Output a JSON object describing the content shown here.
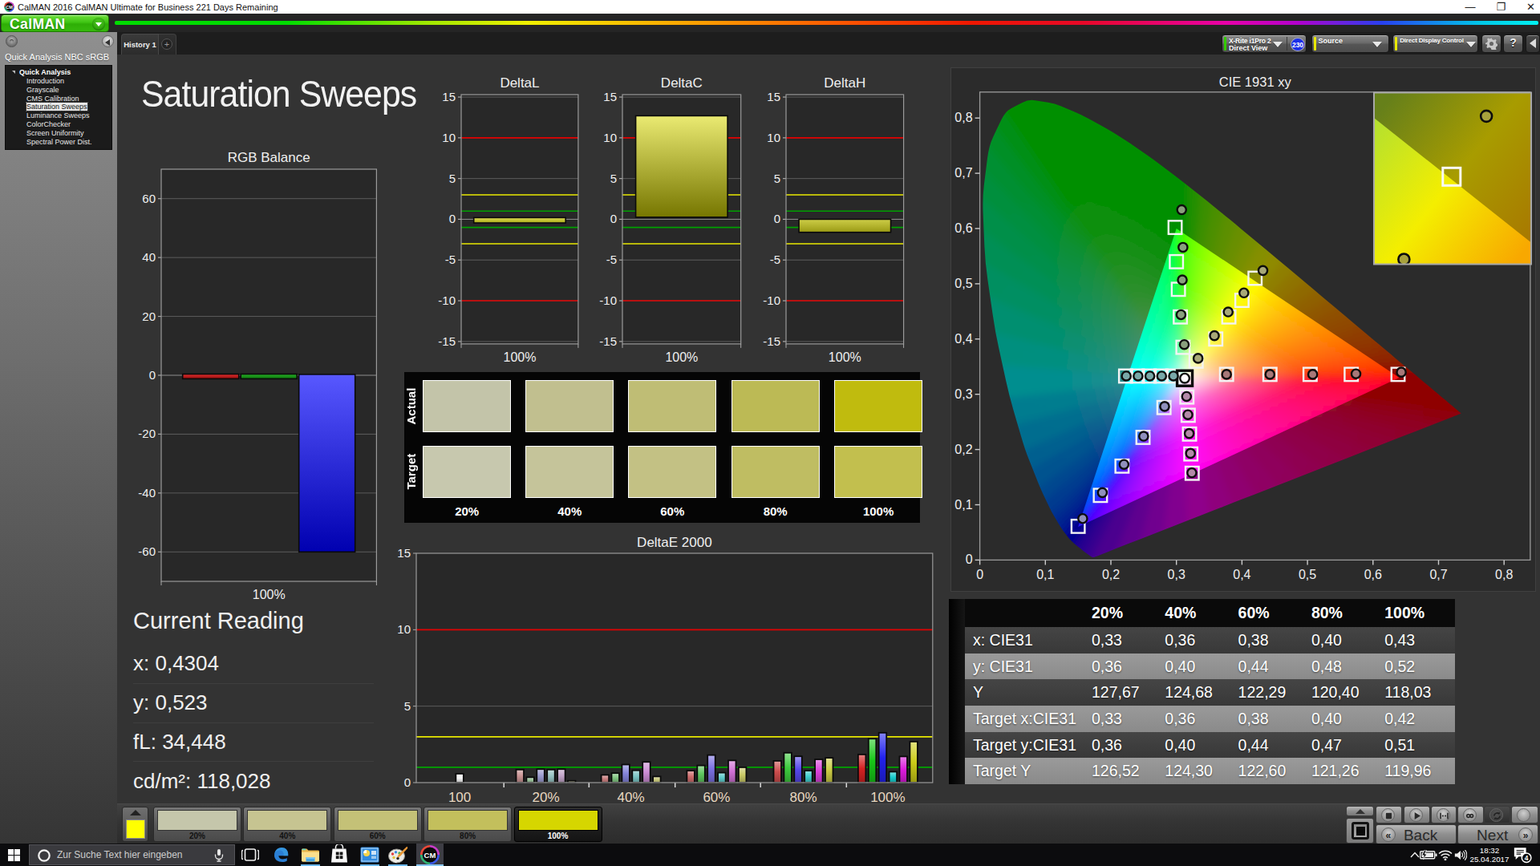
{
  "window": {
    "title": "CalMAN 2016 CalMAN Ultimate for Business 221 Days Remaining",
    "controls": [
      "minimize",
      "restore",
      "close"
    ]
  },
  "logo": {
    "label": "CalMAN"
  },
  "tabs": {
    "active": "History 1",
    "add_label": "+"
  },
  "top_controls": {
    "meter": {
      "line1": "X-Rite i1Pro 2",
      "line2": "Direct View",
      "badge": "230",
      "accent": "#33cc00"
    },
    "source": {
      "line1": "Source",
      "line2": "",
      "accent": "#e8e800"
    },
    "display_control": {
      "line1": "Direct Display Control",
      "line2": "",
      "accent": "#e8e800"
    },
    "buttons": [
      "settings",
      "help",
      "collapse"
    ]
  },
  "sidebar": {
    "title": "Quick Analysis NBC sRGB",
    "root": "Quick Analysis",
    "items": [
      {
        "label": "Introduction",
        "selected": false
      },
      {
        "label": "Grayscale",
        "selected": false
      },
      {
        "label": "CMS Calibration",
        "selected": false
      },
      {
        "label": "Saturation Sweeps",
        "selected": true
      },
      {
        "label": "Luminance Sweeps",
        "selected": false
      },
      {
        "label": "ColorChecker",
        "selected": false
      },
      {
        "label": "Screen Uniformity",
        "selected": false
      },
      {
        "label": "Spectral Power Dist.",
        "selected": false
      }
    ]
  },
  "page": {
    "title": "Saturation Sweeps"
  },
  "current_reading": {
    "title": "Current Reading",
    "values": [
      {
        "label": "x",
        "text": "x: 0,4304"
      },
      {
        "label": "y",
        "text": "y: 0,523"
      },
      {
        "label": "fL",
        "text": "fL: 34,448"
      },
      {
        "label": "cd/m²",
        "text": "cd/m²: 118,028"
      }
    ]
  },
  "chart_data": [
    {
      "id": "rgb_balance",
      "type": "bar",
      "title": "RGB Balance",
      "xlabel": "100%",
      "ylim": [
        -70,
        70
      ],
      "yticks": [
        -60,
        -40,
        -20,
        0,
        20,
        40,
        60
      ],
      "categories": [
        "red",
        "green",
        "blue"
      ],
      "values": [
        -1.2,
        -1.2,
        -60
      ],
      "bar_tops": [
        0.4,
        0.4,
        0.3
      ],
      "colors_top": [
        "#e83030",
        "#28b428",
        "#5858ff"
      ],
      "colors_bot": [
        "#8c0c0c",
        "#0c700c",
        "#0000b0"
      ]
    },
    {
      "id": "deltaL",
      "type": "bar",
      "title": "DeltaL",
      "xlabel": "100%",
      "ylim": [
        -15.3,
        15.3
      ],
      "yticks": [
        -15,
        -10,
        -5,
        0,
        5,
        10,
        15
      ],
      "guides": [
        {
          "y": 10,
          "color": "#e00000"
        },
        {
          "y": -10,
          "color": "#e00000"
        },
        {
          "y": 3,
          "color": "#e8e800"
        },
        {
          "y": -3,
          "color": "#e8e800"
        },
        {
          "y": 1,
          "color": "#00a000"
        },
        {
          "y": -1,
          "color": "#00a000"
        }
      ],
      "categories": [
        "100%"
      ],
      "values": [
        -0.45
      ],
      "bar_tops": [
        0.2
      ],
      "colors_top": [
        "#dede52"
      ],
      "colors_bot": [
        "#a8a818"
      ]
    },
    {
      "id": "deltaC",
      "type": "bar",
      "title": "DeltaC",
      "xlabel": "100%",
      "ylim": [
        -15.3,
        15.3
      ],
      "yticks": [
        -15,
        -10,
        -5,
        0,
        5,
        10,
        15
      ],
      "guides": [
        {
          "y": 10,
          "color": "#e00000"
        },
        {
          "y": -10,
          "color": "#e00000"
        },
        {
          "y": 3,
          "color": "#e8e800"
        },
        {
          "y": -3,
          "color": "#e8e800"
        },
        {
          "y": 1,
          "color": "#00a000"
        },
        {
          "y": -1,
          "color": "#00a000"
        }
      ],
      "categories": [
        "100%"
      ],
      "values": [
        12.7
      ],
      "bar_tops": [
        0.25
      ],
      "colors_top": [
        "#eaea72"
      ],
      "colors_bot": [
        "#767600"
      ]
    },
    {
      "id": "deltaH",
      "type": "bar",
      "title": "DeltaH",
      "xlabel": "100%",
      "ylim": [
        -15.3,
        15.3
      ],
      "yticks": [
        -15,
        -10,
        -5,
        0,
        5,
        10,
        15
      ],
      "guides": [
        {
          "y": 10,
          "color": "#e00000"
        },
        {
          "y": -10,
          "color": "#e00000"
        },
        {
          "y": 3,
          "color": "#e8e800"
        },
        {
          "y": -3,
          "color": "#e8e800"
        },
        {
          "y": 1,
          "color": "#00a000"
        },
        {
          "y": -1,
          "color": "#00a000"
        }
      ],
      "categories": [
        "100%"
      ],
      "values": [
        -1.6
      ],
      "bar_tops": [
        0.0
      ],
      "colors_top": [
        "#cece48"
      ],
      "colors_bot": [
        "#9a9a14"
      ]
    },
    {
      "id": "deltaE",
      "type": "bar",
      "title": "DeltaE 2000",
      "ylim": [
        0,
        15
      ],
      "yticks": [
        0,
        5,
        10,
        15
      ],
      "guides": [
        {
          "y": 10,
          "color": "#e00000"
        },
        {
          "y": 3,
          "color": "#e8e800"
        },
        {
          "y": 1,
          "color": "#00a400"
        }
      ],
      "categories": [
        "100",
        "20%",
        "40%",
        "60%",
        "80%",
        "100%"
      ],
      "series_labels": [
        "white",
        "red",
        "green",
        "blue",
        "cyan",
        "magenta",
        "yellow"
      ],
      "groups": [
        {
          "label": "100",
          "values": [
            0.58
          ],
          "colors": [
            "#f2f2f2"
          ]
        },
        {
          "label": "20%",
          "values": [
            0.85,
            0.35,
            0.88,
            0.85,
            0.88,
            0.12
          ],
          "colors": [
            "#c89292",
            "#9cc49c",
            "#9a9ace",
            "#96c2c2",
            "#c2a4c8",
            "#c8c89c"
          ]
        },
        {
          "label": "40%",
          "values": [
            0.5,
            0.62,
            1.18,
            0.8,
            1.35,
            0.4
          ],
          "colors": [
            "#c87e7e",
            "#80c480",
            "#8484da",
            "#7ac4c4",
            "#cc8cd4",
            "#caca7e"
          ]
        },
        {
          "label": "60%",
          "values": [
            0.78,
            1.12,
            1.8,
            0.65,
            1.45,
            1.0
          ],
          "colors": [
            "#cc6a6a",
            "#5ec65e",
            "#7a70e2",
            "#5ecaca",
            "#d070d4",
            "#caca66"
          ]
        },
        {
          "label": "80%",
          "values": [
            1.42,
            1.95,
            1.72,
            0.78,
            1.52,
            1.62
          ],
          "colors": [
            "#cc4c4c",
            "#3ecc3e",
            "#5648ec",
            "#3ecccc",
            "#dc42dc",
            "#cccc44"
          ]
        },
        {
          "label": "100%",
          "values": [
            1.84,
            2.87,
            3.26,
            0.71,
            1.71,
            2.68
          ],
          "colors": [
            "#d42222",
            "#18c818",
            "#2222ee",
            "#18cccc",
            "#dd1cdd",
            "#cccc18"
          ]
        }
      ]
    },
    {
      "id": "cie",
      "type": "scatter",
      "title": "CIE 1931 xy",
      "xlim": [
        0,
        0.84
      ],
      "ylim": [
        0,
        0.847
      ],
      "xticks": [
        "0",
        "0,1",
        "0,2",
        "0,3",
        "0,4",
        "0,5",
        "0,6",
        "0,7",
        "0,8"
      ],
      "yticks": [
        "0",
        "0,1",
        "0,2",
        "0,3",
        "0,4",
        "0,5",
        "0,6",
        "0,7",
        "0,8"
      ],
      "white_point": {
        "x": 0.3127,
        "y": 0.329
      },
      "targets": {
        "red": [
          [
            0.3765,
            0.336
          ],
          [
            0.4427,
            0.336
          ],
          [
            0.504,
            0.336
          ],
          [
            0.5668,
            0.336
          ],
          [
            0.6382,
            0.336
          ]
        ],
        "green": [
          [
            0.31,
            0.385
          ],
          [
            0.306,
            0.44
          ],
          [
            0.303,
            0.49
          ],
          [
            0.3,
            0.54
          ],
          [
            0.298,
            0.602
          ]
        ],
        "blue": [
          [
            0.281,
            0.276
          ],
          [
            0.249,
            0.222
          ],
          [
            0.217,
            0.17
          ],
          [
            0.184,
            0.117
          ],
          [
            0.15,
            0.061
          ]
        ],
        "cyan": [
          [
            0.2225,
            0.333
          ],
          [
            0.2405,
            0.333
          ],
          [
            0.2585,
            0.333
          ],
          [
            0.2765,
            0.333
          ],
          [
            0.2945,
            0.333
          ]
        ],
        "magenta": [
          [
            0.316,
            0.295
          ],
          [
            0.318,
            0.262
          ],
          [
            0.32,
            0.228
          ],
          [
            0.322,
            0.192
          ],
          [
            0.324,
            0.157
          ]
        ],
        "yellow": [
          [
            0.33,
            0.36
          ],
          [
            0.36,
            0.4
          ],
          [
            0.38,
            0.44
          ],
          [
            0.4,
            0.47
          ],
          [
            0.42,
            0.51
          ]
        ]
      },
      "measured": {
        "red": [
          [
            0.3765,
            0.336
          ],
          [
            0.4427,
            0.336
          ],
          [
            0.508,
            0.336
          ],
          [
            0.574,
            0.337
          ],
          [
            0.6432,
            0.34
          ]
        ],
        "green": [
          [
            0.312,
            0.39
          ],
          [
            0.307,
            0.444
          ],
          [
            0.309,
            0.507
          ],
          [
            0.31,
            0.566
          ],
          [
            0.308,
            0.634
          ]
        ],
        "blue": [
          [
            0.282,
            0.278
          ],
          [
            0.25,
            0.224
          ],
          [
            0.22,
            0.173
          ],
          [
            0.187,
            0.122
          ],
          [
            0.157,
            0.075
          ]
        ],
        "cyan": [
          [
            0.2235,
            0.333
          ],
          [
            0.2415,
            0.333
          ],
          [
            0.2595,
            0.333
          ],
          [
            0.2775,
            0.333
          ],
          [
            0.2955,
            0.333
          ]
        ],
        "magenta": [
          [
            0.3155,
            0.296
          ],
          [
            0.3175,
            0.263
          ],
          [
            0.3195,
            0.229
          ],
          [
            0.3215,
            0.193
          ],
          [
            0.3235,
            0.158
          ]
        ],
        "yellow": [
          [
            0.333,
            0.365
          ],
          [
            0.358,
            0.406
          ],
          [
            0.379,
            0.449
          ],
          [
            0.403,
            0.4835
          ],
          [
            0.432,
            0.524
          ]
        ]
      },
      "dot_fills": {
        "red": "#a87878",
        "green": "#8aa07e",
        "blue": "#9090bc",
        "cyan": "#78a8a8",
        "magenta": "#b48aa8",
        "yellow": "#a8a878",
        "white": "#ffffff"
      },
      "inset": {
        "center": [
          0.41967,
          0.50529
        ],
        "span": 0.028,
        "square": [
          0.4195,
          0.5056
        ],
        "circles": [
          [
            0.42569,
            0.51638
          ],
          [
            0.41101,
            0.49087
          ]
        ]
      }
    }
  ],
  "swatch_panel": {
    "row_labels": [
      "Actual",
      "Target"
    ],
    "col_labels": [
      "20%",
      "40%",
      "60%",
      "80%",
      "100%"
    ],
    "actual": [
      "#c3c4a9",
      "#c1bf8f",
      "#bfbd75",
      "#bcba55",
      "#c0bb0e"
    ],
    "target": [
      "#c7c8ae",
      "#c5c49a",
      "#c3c184",
      "#bfbd62",
      "#c2bf4e"
    ]
  },
  "data_table": {
    "col_headers": [
      "20%",
      "40%",
      "60%",
      "80%",
      "100%"
    ],
    "rows": [
      {
        "label": "x: CIE31",
        "values": [
          "0,33",
          "0,36",
          "0,38",
          "0,40",
          "0,43"
        ],
        "shade": "dark"
      },
      {
        "label": "y: CIE31",
        "values": [
          "0,36",
          "0,40",
          "0,44",
          "0,48",
          "0,52"
        ],
        "shade": "lite"
      },
      {
        "label": "Y",
        "values": [
          "127,67",
          "124,68",
          "122,29",
          "120,40",
          "118,03"
        ],
        "shade": "dark"
      },
      {
        "label": "Target x:CIE31",
        "values": [
          "0,33",
          "0,36",
          "0,38",
          "0,40",
          "0,42"
        ],
        "shade": "lite"
      },
      {
        "label": "Target y:CIE31",
        "values": [
          "0,36",
          "0,40",
          "0,44",
          "0,47",
          "0,51"
        ],
        "shade": "dark"
      },
      {
        "label": "Target Y",
        "values": [
          "126,52",
          "124,30",
          "122,60",
          "121,26",
          "119,96"
        ],
        "shade": "lite"
      }
    ]
  },
  "bottom_bar": {
    "current_patch": "#ffff00",
    "patches": [
      {
        "label": "20%",
        "color": "#c5c6ab",
        "selected": false
      },
      {
        "label": "40%",
        "color": "#c6c491",
        "selected": false
      },
      {
        "label": "60%",
        "color": "#c4c177",
        "selected": false
      },
      {
        "label": "80%",
        "color": "#c3bf5c",
        "selected": false
      },
      {
        "label": "100%",
        "color": "#d6d600",
        "selected": true
      }
    ],
    "back_label": "Back",
    "next_label": "Next",
    "transport_icons": [
      "stop",
      "play",
      "single-measure",
      "continuous",
      "refresh",
      "record"
    ]
  },
  "taskbar": {
    "search_placeholder": "Zur Suche Text hier eingeben",
    "icons": [
      "start",
      "cortana-search",
      "microphone",
      "task-view",
      "edge",
      "file-explorer",
      "store",
      "photos",
      "paint",
      "calman"
    ],
    "running": [
      "file-explorer",
      "photos",
      "paint",
      "calman"
    ],
    "active": "calman",
    "tray": [
      "chevron-up",
      "battery",
      "wifi",
      "volume",
      "clock",
      "notifications"
    ],
    "time": "18:32",
    "date": "25.04.2017",
    "notification_count": "4"
  }
}
